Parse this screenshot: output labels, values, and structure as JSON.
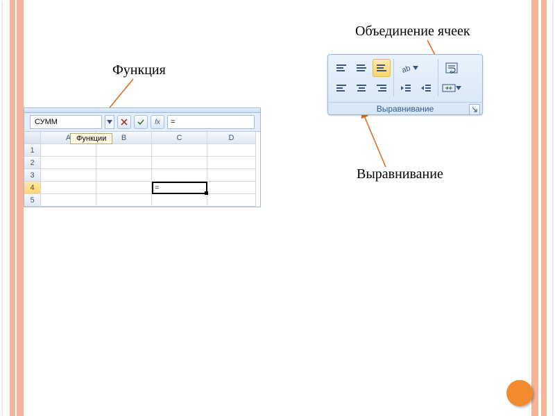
{
  "labels": {
    "function": "Функция",
    "merge_cells": "Объединение ячеек",
    "alignment": "Выравнивание"
  },
  "excel": {
    "namebox_value": "СУММ",
    "fn_tooltip": "Функции",
    "formula_bar_value": "=",
    "columns": [
      "A",
      "B",
      "C",
      "D"
    ],
    "rows": [
      "1",
      "2",
      "3",
      "4",
      "5"
    ],
    "active_cell_row": "4",
    "active_cell_col": "C",
    "active_cell_value": "="
  },
  "ribbon": {
    "group_title": "Выравнивание",
    "btns": {
      "valign_top": "align-top",
      "valign_mid": "align-middle",
      "valign_bot": "align-bottom",
      "orient": "orientation",
      "wrap": "wrap-text",
      "halign_left": "align-left",
      "halign_center": "align-center",
      "halign_right": "align-right",
      "indent_dec": "decrease-indent",
      "indent_inc": "increase-indent",
      "merge": "merge-center"
    }
  },
  "colors": {
    "accent_stripe": "#f3b498",
    "page_circle": "#f28a2e",
    "ribbon_bg": "#e0ecf8",
    "link_blue": "#2a5a95"
  }
}
